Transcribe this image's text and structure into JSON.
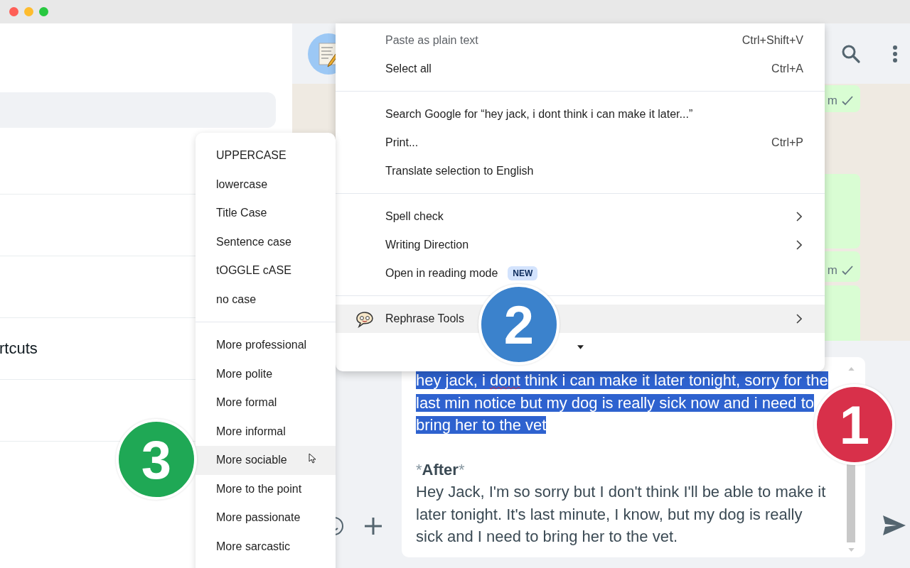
{
  "window": {
    "controls": [
      {
        "color": "#fe5f57"
      },
      {
        "color": "#febc2e"
      },
      {
        "color": "#28c840"
      }
    ]
  },
  "sidebar": {
    "rows": [
      {
        "text": ""
      },
      {
        "text": ""
      },
      {
        "text": ""
      },
      {
        "text": "rtcuts"
      },
      {
        "text": ""
      }
    ]
  },
  "chat": {
    "messages": [
      {
        "kind": "time",
        "time": "m",
        "ticks": true
      },
      {
        "kind": "blank"
      },
      {
        "kind": "time",
        "time": "m",
        "ticks": true
      },
      {
        "kind": "blank"
      }
    ]
  },
  "composer": {
    "selection": {
      "selected": true,
      "segments": [
        {
          "text": "hey jack, i ",
          "misspelled": false
        },
        {
          "text": "dont",
          "misspelled": true
        },
        {
          "text": " think i can make it later tonight, sorry for the last min notice but my dog is really sick now and i need to bring her to the vet",
          "misspelled": false
        }
      ]
    },
    "heading": {
      "open": "*",
      "text": "After",
      "close": "*"
    },
    "body": "Hey Jack, I'm so sorry but I don't think I'll be able to make it later tonight. It's last minute, I know, but my dog is really sick and I need to bring her to the vet."
  },
  "context_menu": {
    "items": [
      {
        "kind": "item",
        "label": "Paste as plain text",
        "shortcut": "Ctrl+Shift+V",
        "disabled": true,
        "selected": false,
        "submenu": false
      },
      {
        "kind": "item",
        "label": "Select all",
        "shortcut": "Ctrl+A",
        "disabled": false,
        "selected": false,
        "submenu": false
      },
      {
        "kind": "divider"
      },
      {
        "kind": "item",
        "label": "Search Google for “hey jack, i dont think i can make it later...”",
        "disabled": false,
        "selected": false,
        "submenu": false
      },
      {
        "kind": "item",
        "label": "Print...",
        "shortcut": "Ctrl+P",
        "disabled": false,
        "selected": false,
        "submenu": false
      },
      {
        "kind": "item",
        "label": "Translate selection to English",
        "disabled": false,
        "selected": false,
        "submenu": false
      },
      {
        "kind": "divider"
      },
      {
        "kind": "item",
        "label": "Spell check",
        "disabled": false,
        "selected": false,
        "submenu": true
      },
      {
        "kind": "item",
        "label": "Writing Direction",
        "disabled": false,
        "selected": false,
        "submenu": true
      },
      {
        "kind": "item",
        "label": "Open in reading mode",
        "badge": "NEW",
        "disabled": false,
        "selected": false,
        "submenu": false
      },
      {
        "kind": "divider"
      },
      {
        "kind": "icon_item",
        "label": "Rephrase Tools",
        "disabled": false,
        "selected": true,
        "submenu": true
      },
      {
        "kind": "caret"
      }
    ]
  },
  "submenu": {
    "items": [
      {
        "kind": "item",
        "label": "UPPERCASE",
        "selected": false
      },
      {
        "kind": "item",
        "label": "lowercase",
        "selected": false
      },
      {
        "kind": "item",
        "label": "Title Case",
        "selected": false
      },
      {
        "kind": "item",
        "label": "Sentence case",
        "selected": false
      },
      {
        "kind": "item",
        "label": "tOGGLE cASE",
        "selected": false
      },
      {
        "kind": "item",
        "label": "no case",
        "selected": false
      },
      {
        "kind": "divider"
      },
      {
        "kind": "item",
        "label": "More professional",
        "selected": false
      },
      {
        "kind": "item",
        "label": "More polite",
        "selected": false
      },
      {
        "kind": "item",
        "label": "More formal",
        "selected": false
      },
      {
        "kind": "item",
        "label": "More informal",
        "selected": false
      },
      {
        "kind": "item",
        "label": "More sociable",
        "selected": true
      },
      {
        "kind": "item",
        "label": "More to the point",
        "selected": false
      },
      {
        "kind": "item",
        "label": "More passionate",
        "selected": false
      },
      {
        "kind": "item",
        "label": "More sarcastic",
        "selected": false
      }
    ]
  },
  "steps": [
    {
      "number": "1",
      "color": "#d8304a"
    },
    {
      "number": "2",
      "color": "#3b82cc"
    },
    {
      "number": "3",
      "color": "#1fa855"
    }
  ]
}
